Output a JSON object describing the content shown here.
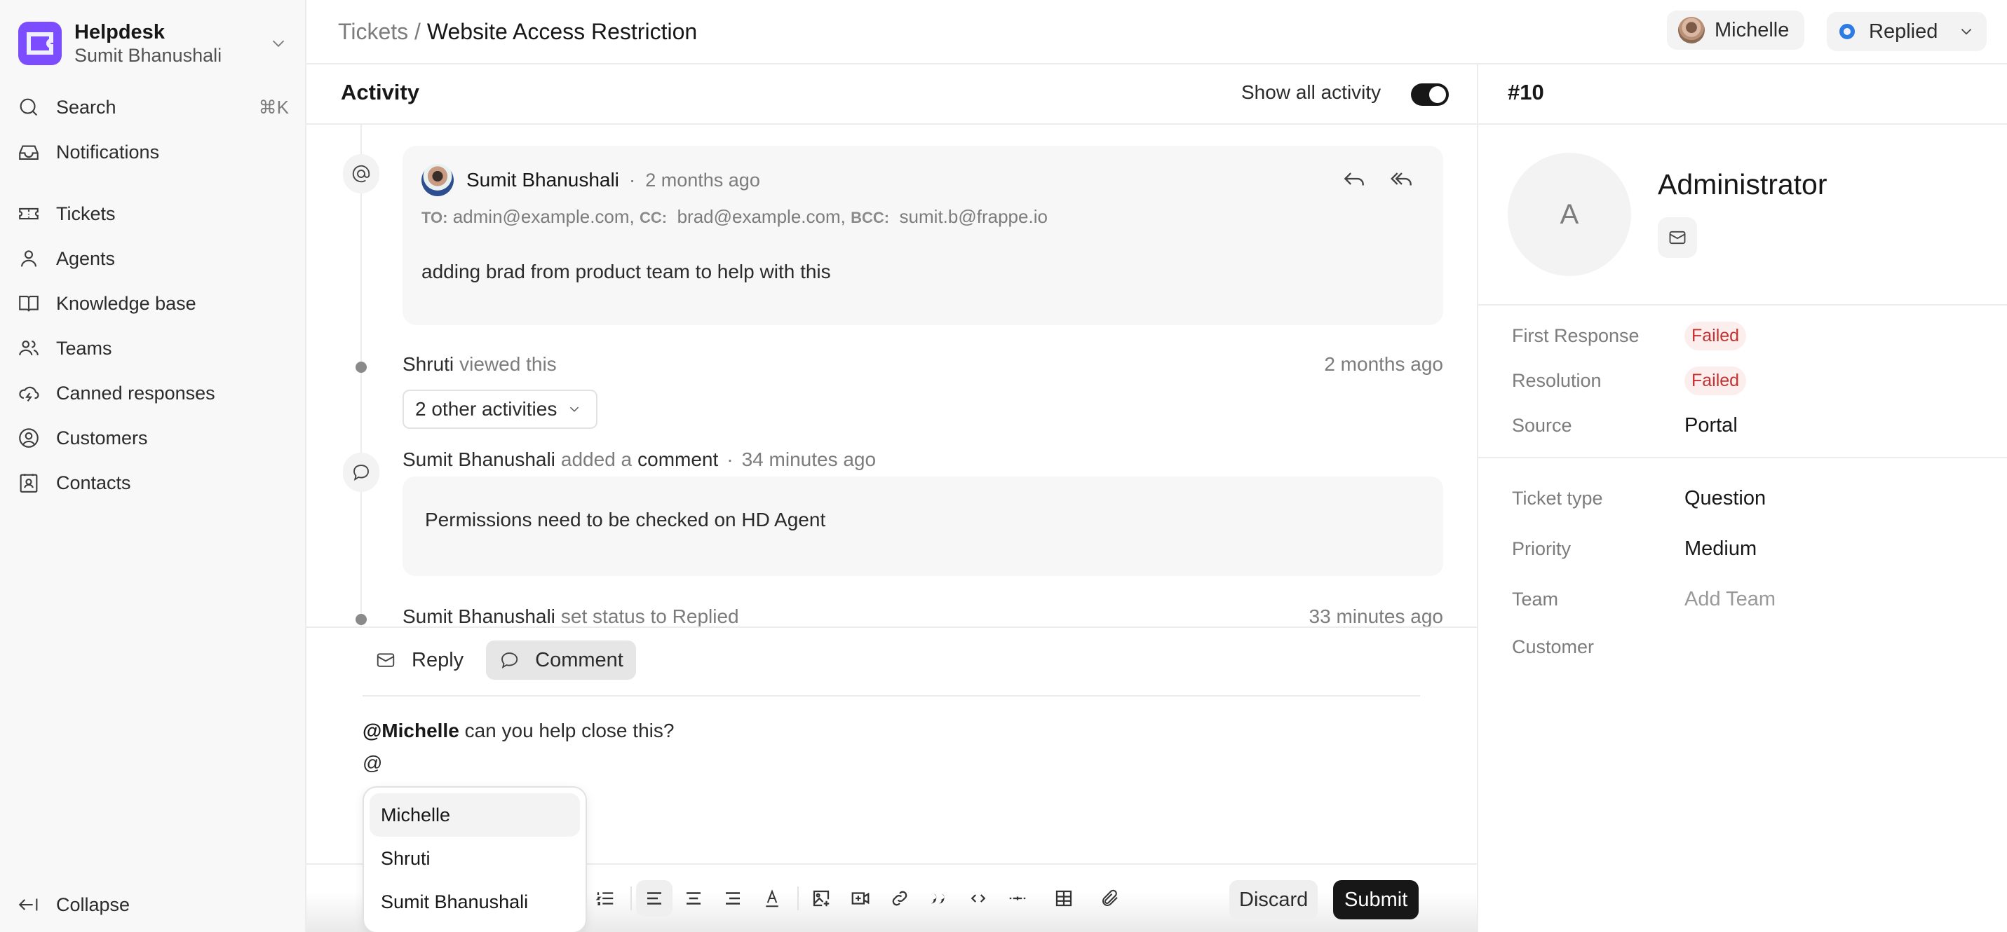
{
  "sidebar": {
    "brand": {
      "title": "Helpdesk",
      "subtitle": "Sumit Bhanushali",
      "logo_color": "#7c4dff"
    },
    "search": {
      "label": "Search",
      "shortcut": "⌘K"
    },
    "notifications": {
      "label": "Notifications"
    },
    "items": [
      {
        "label": "Tickets",
        "icon": "ticket-icon"
      },
      {
        "label": "Agents",
        "icon": "user-icon"
      },
      {
        "label": "Knowledge base",
        "icon": "book-icon"
      },
      {
        "label": "Teams",
        "icon": "users-icon"
      },
      {
        "label": "Canned responses",
        "icon": "cloud-lightning-icon"
      },
      {
        "label": "Customers",
        "icon": "user-circle-icon"
      },
      {
        "label": "Contacts",
        "icon": "contact-card-icon"
      }
    ],
    "collapse": {
      "label": "Collapse"
    }
  },
  "header": {
    "breadcrumb_parent": "Tickets",
    "breadcrumb_sep": "/",
    "title": "Website Access Restriction",
    "assignee": "Michelle",
    "status": {
      "label": "Replied",
      "color": "#2d7be5"
    }
  },
  "activity": {
    "title": "Activity",
    "show_all_label": "Show all activity",
    "show_all_on": true,
    "email": {
      "author": "Sumit Bhanushali",
      "sep": "·",
      "time": "2 months ago",
      "to_label": "TO:",
      "to": "admin@example.com,",
      "cc_label": "CC:",
      "cc": "brad@example.com,",
      "bcc_label": "BCC:",
      "bcc": "sumit.b@frappe.io",
      "body": "adding brad from product team to help with this"
    },
    "view_event": {
      "actor": "Shruti",
      "verb": "viewed this",
      "time": "2 months ago"
    },
    "other_activities": "2 other activities",
    "comment": {
      "actor": "Sumit Bhanushali",
      "verb": "added a",
      "object": "comment",
      "sep": "·",
      "time": "34 minutes ago",
      "body": "Permissions need to be checked on HD Agent"
    },
    "status_event": {
      "actor": "Sumit Bhanushali",
      "verb": "set status to Replied",
      "time": "33 minutes ago"
    }
  },
  "editor": {
    "tabs": [
      {
        "label": "Reply",
        "active": false
      },
      {
        "label": "Comment",
        "active": true
      }
    ],
    "mention": "@Michelle",
    "text": " can you help close this?",
    "line2": "@",
    "mention_options": [
      "Michelle",
      "Shruti",
      "Sumit Bhanushali"
    ],
    "discard_label": "Discard",
    "submit_label": "Submit"
  },
  "ticket": {
    "id": "#10",
    "contact_initial": "A",
    "contact_name": "Administrator",
    "sla": [
      {
        "label": "First Response",
        "value": "Failed"
      },
      {
        "label": "Resolution",
        "value": "Failed"
      }
    ],
    "source_label": "Source",
    "source": "Portal",
    "fields": [
      {
        "label": "Ticket type",
        "value": "Question"
      },
      {
        "label": "Priority",
        "value": "Medium"
      },
      {
        "label": "Team",
        "value": "Add Team"
      },
      {
        "label": "Customer",
        "value": ""
      }
    ]
  }
}
